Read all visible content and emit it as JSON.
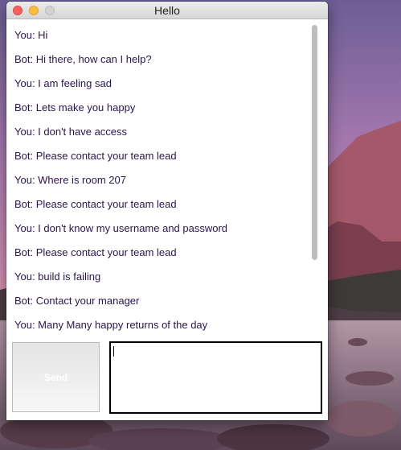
{
  "window": {
    "title": "Hello",
    "controls": {
      "close": "close-icon",
      "minimize": "minimize-icon",
      "zoom": "zoom-icon"
    }
  },
  "chat": {
    "messages": [
      "You: Hi",
      "Bot: Hi there, how can I help?",
      "You: I am feeling sad",
      "Bot: Lets make you happy",
      "You: I don't have access",
      "Bot: Please contact your team lead",
      "You: Where is room 207",
      "Bot: Please contact your team lead",
      "You: I don't know my username and password",
      "Bot: Please contact your team lead",
      "You: build is failing",
      "Bot: Contact your manager",
      "You: Many Many happy returns of the day"
    ]
  },
  "composer": {
    "send_label": "Send",
    "input_value": ""
  },
  "colors": {
    "message_text": "#2a1550",
    "close": "#fc605b",
    "minimize": "#fdbc40",
    "zoom_inactive": "#d2d2d2"
  }
}
